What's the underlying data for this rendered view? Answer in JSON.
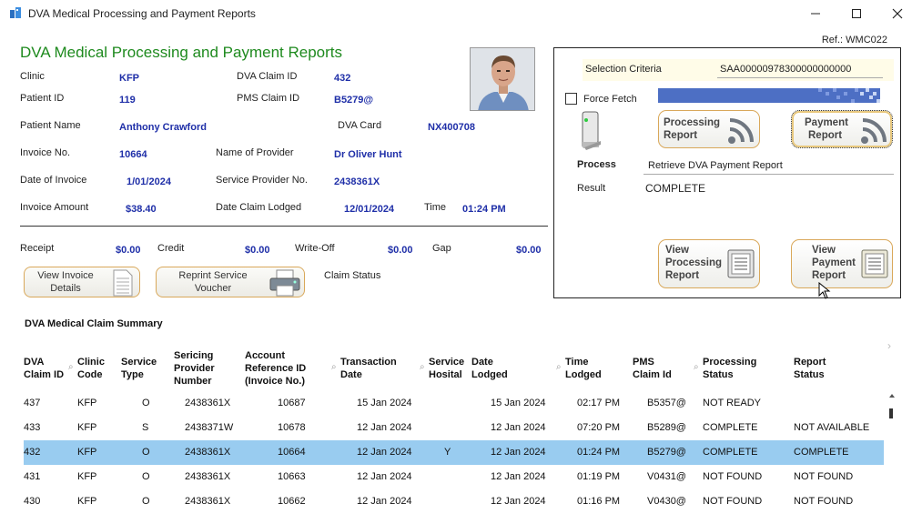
{
  "window": {
    "title": "DVA  Medical Processing and Payment Reports",
    "ref": "Ref.: WMC022"
  },
  "header": {
    "title": "DVA  Medical Processing and Payment Reports"
  },
  "details": {
    "clinic_label": "Clinic",
    "clinic": "KFP",
    "dva_claim_id_label": "DVA Claim ID",
    "dva_claim_id": "432",
    "patient_id_label": "Patient ID",
    "patient_id": "119",
    "pms_claim_id_label": "PMS Claim ID",
    "pms_claim_id": "B5279@",
    "patient_name_label": "Patient Name",
    "patient_name": "Anthony Crawford",
    "dva_card_label": "DVA Card",
    "dva_card": "NX400708",
    "invoice_no_label": "Invoice No.",
    "invoice_no": "10664",
    "provider_name_label": "Name of Provider",
    "provider_name": "Dr Oliver Hunt",
    "invoice_date_label": "Date of Invoice",
    "invoice_date": "1/01/2024",
    "provider_no_label": "Service Provider No.",
    "provider_no": "2438361X",
    "invoice_amount_label": "Invoice Amount",
    "invoice_amount": "$38.40",
    "date_lodged_label": "Date Claim Lodged",
    "date_lodged": "12/01/2024",
    "time_label": "Time",
    "time": "01:24 PM",
    "receipt_label": "Receipt",
    "receipt": "$0.00",
    "credit_label": "Credit",
    "credit": "$0.00",
    "writeoff_label": "Write-Off",
    "writeoff": "$0.00",
    "gap_label": "Gap",
    "gap": "$0.00",
    "claim_status_label": "Claim Status"
  },
  "buttons": {
    "view_invoice": [
      "View Invoice",
      "Details"
    ],
    "reprint_voucher": [
      "Reprint Service",
      "Voucher"
    ]
  },
  "process_panel": {
    "selection_label": "Selection Criteria",
    "selection_value": "SAA00000978300000000000",
    "force_fetch_label": "Force Fetch",
    "force_fetch_checked": false,
    "processing_report": [
      "Processing",
      "Report"
    ],
    "payment_report": [
      "Payment",
      "Report"
    ],
    "process_label": "Process",
    "process_value": "Retrieve DVA Payment Report",
    "result_label": "Result",
    "result_value": "COMPLETE",
    "view_processing_report": [
      "View",
      "Processing",
      "Report"
    ],
    "view_payment_report": [
      "View",
      "Payment",
      "Report"
    ]
  },
  "summary": {
    "title": "DVA Medical Claim Summary",
    "columns": [
      [
        "DVA",
        "Claim ID"
      ],
      [
        "Clinic",
        "Code"
      ],
      [
        "Service",
        "Type"
      ],
      [
        "Sericing",
        "Provider",
        "Number"
      ],
      [
        "Account",
        "Reference ID",
        "(Invoice No.)"
      ],
      [
        "Transaction",
        "Date"
      ],
      [
        "Service",
        "Hosital"
      ],
      [
        "Date",
        "Lodged"
      ],
      [
        "Time",
        "Lodged"
      ],
      [
        "PMS",
        "Claim Id"
      ],
      [
        "Processing",
        "Status"
      ],
      [
        "Report",
        "Status"
      ]
    ],
    "rows": [
      [
        "437",
        "KFP",
        "O",
        "2438361X",
        "10687",
        "15 Jan 2024",
        "",
        "15 Jan 2024",
        "02:17 PM",
        "B5357@",
        "NOT READY",
        ""
      ],
      [
        "433",
        "KFP",
        "S",
        "2438371W",
        "10678",
        "12 Jan 2024",
        "",
        "12 Jan 2024",
        "07:20 PM",
        "B5289@",
        "COMPLETE",
        "NOT AVAILABLE"
      ],
      [
        "432",
        "KFP",
        "O",
        "2438361X",
        "10664",
        "12 Jan 2024",
        "Y",
        "12 Jan 2024",
        "01:24 PM",
        "B5279@",
        "COMPLETE",
        "COMPLETE"
      ],
      [
        "431",
        "KFP",
        "O",
        "2438361X",
        "10663",
        "12 Jan 2024",
        "",
        "12 Jan 2024",
        "01:19 PM",
        "V0431@",
        "NOT FOUND",
        "NOT FOUND"
      ],
      [
        "430",
        "KFP",
        "O",
        "2438361X",
        "10662",
        "12 Jan 2024",
        "",
        "12 Jan 2024",
        "01:16 PM",
        "V0430@",
        "NOT FOUND",
        "NOT FOUND"
      ]
    ],
    "selected_row": 2
  },
  "colors": {
    "accent_green": "#1e8a1e",
    "value_blue": "#1f2fa8",
    "selected_row": "#99ccf0",
    "button_border": "#d9a85a"
  }
}
